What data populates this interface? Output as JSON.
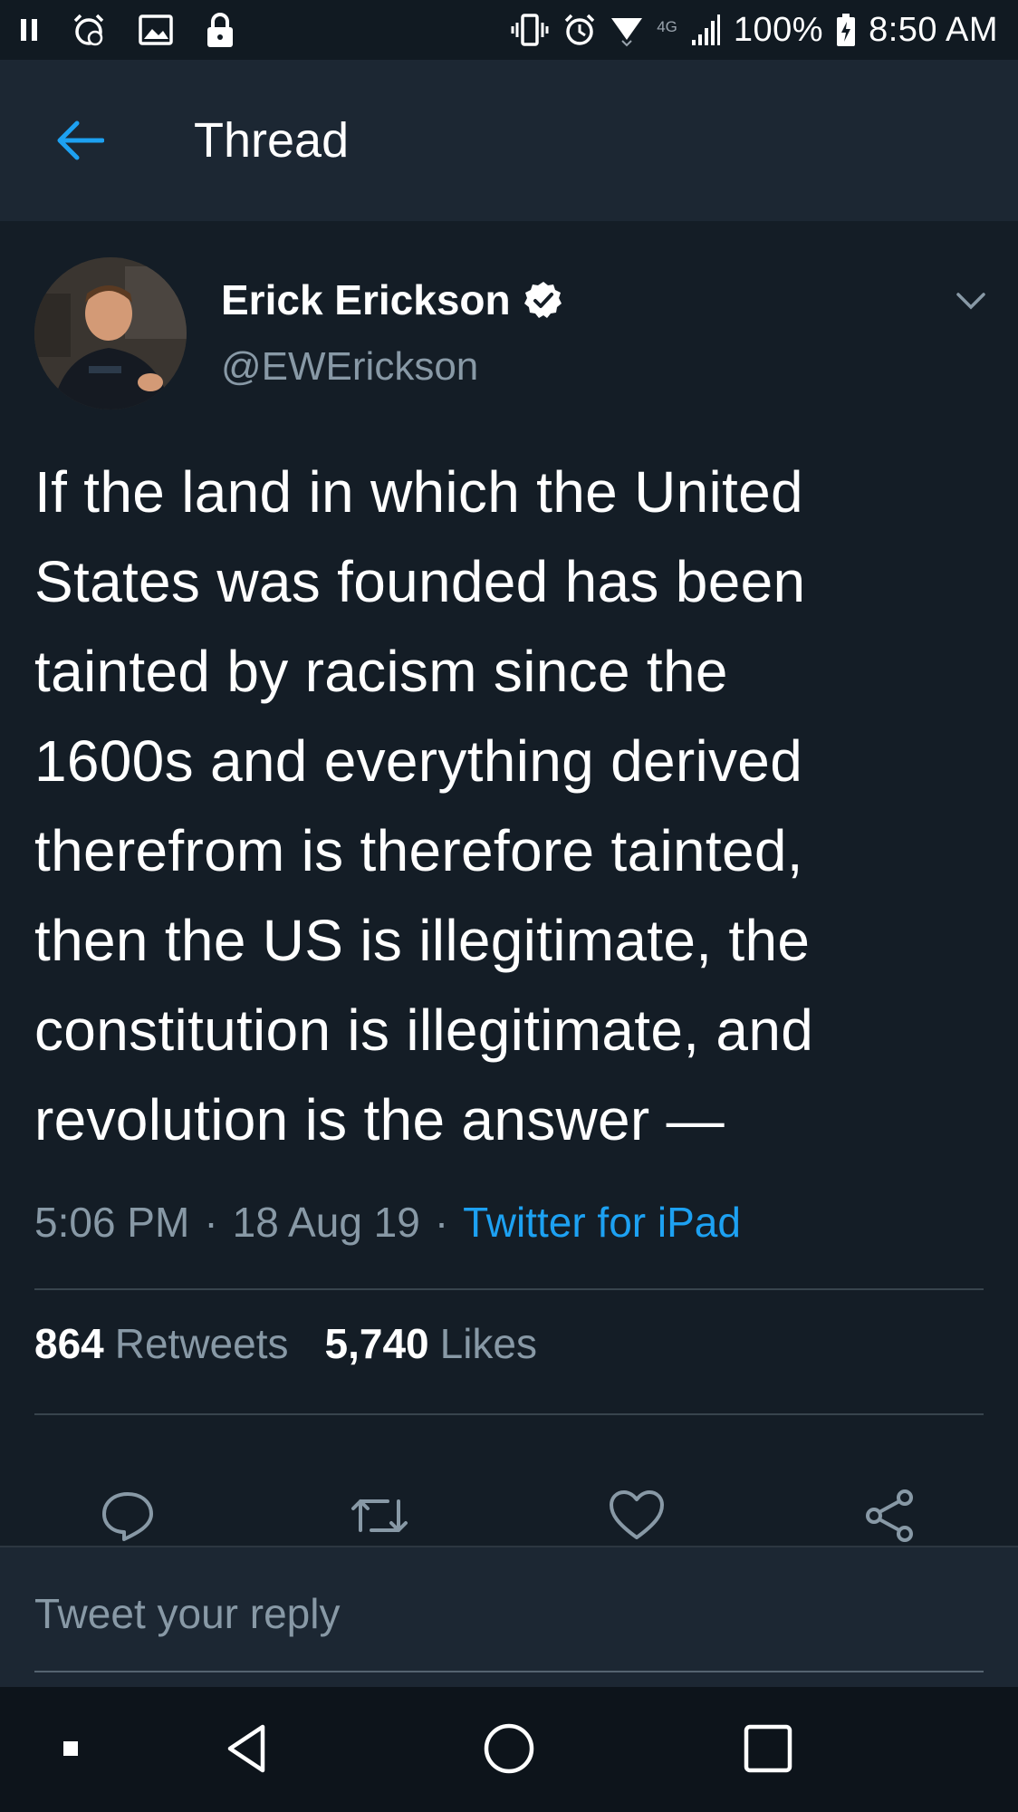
{
  "status_bar": {
    "network_type": "4G",
    "battery": "100%",
    "time": "8:50 AM"
  },
  "app_bar": {
    "title": "Thread"
  },
  "tweet": {
    "author_name": "Erick Erickson",
    "handle": "@EWErickson",
    "text_lines": [
      "If the land in which the United",
      "States was founded has been",
      "tainted by racism since the",
      "1600s and everything derived",
      "therefrom is therefore tainted,",
      "then the US is illegitimate, the",
      "constitution is illegitimate, and",
      "revolution is the answer —"
    ],
    "time": "5:06 PM",
    "date": "18 Aug 19",
    "source": "Twitter for iPad",
    "separator": "·",
    "retweets_count": "864",
    "retweets_label": "Retweets",
    "likes_count": "5,740",
    "likes_label": "Likes"
  },
  "reply": {
    "placeholder": "Tweet your reply"
  },
  "colors": {
    "background": "#141d26",
    "bar": "#1c2733",
    "accent": "#1da1f2",
    "secondary_text": "#8899a6"
  },
  "icons": {
    "back": "arrow-left-icon",
    "verified": "verified-badge-icon",
    "caret": "chevron-down-icon",
    "reply": "reply-icon",
    "retweet": "retweet-icon",
    "like": "heart-icon",
    "share": "share-icon"
  }
}
